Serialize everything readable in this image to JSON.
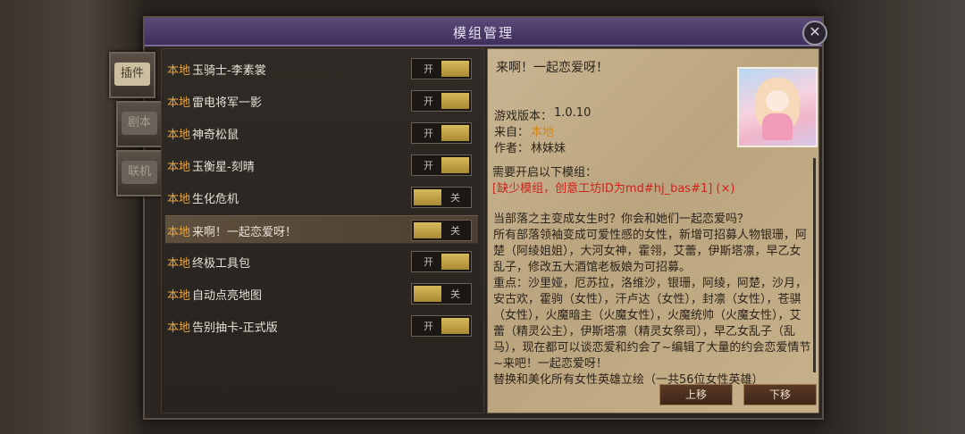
{
  "dialog": {
    "title": "模组管理"
  },
  "side_tabs": [
    {
      "label": "插件",
      "active": true
    },
    {
      "label": "剧本",
      "active": false
    },
    {
      "label": "联机",
      "active": false
    }
  ],
  "mods": [
    {
      "source": "本地",
      "name": "玉骑士-李素裳",
      "state": "开",
      "enabled": true
    },
    {
      "source": "本地",
      "name": "雷电将军一影",
      "state": "开",
      "enabled": true
    },
    {
      "source": "本地",
      "name": "神奇松鼠",
      "state": "开",
      "enabled": true
    },
    {
      "source": "本地",
      "name": "玉衡星-刻晴",
      "state": "开",
      "enabled": true
    },
    {
      "source": "本地",
      "name": "生化危机",
      "state": "关",
      "enabled": false
    },
    {
      "source": "本地",
      "name": "来啊！一起恋爱呀！",
      "state": "关",
      "enabled": false,
      "selected": true
    },
    {
      "source": "本地",
      "name": "终极工具包",
      "state": "开",
      "enabled": true
    },
    {
      "source": "本地",
      "name": "自动点亮地图",
      "state": "关",
      "enabled": false
    },
    {
      "source": "本地",
      "name": "告别抽卡-正式版",
      "state": "开",
      "enabled": true
    }
  ],
  "detail": {
    "title": "来啊！一起恋爱呀！",
    "version_label": "游戏版本：",
    "version": "1.0.10",
    "from_label": "来自：",
    "from": "本地",
    "author_label": "作者：",
    "author": "林妹妹",
    "requires_label": "需要开启以下模组：",
    "requires_missing": "[缺少模组，创意工坊ID为md#hj_bas#1] (×)",
    "description": [
      "当部落之主变成女生时？你会和她们一起恋爱吗？",
      "所有部落领袖变成可爱性感的女性，新增可招募人物银珊，阿楚（阿绫姐姐），大河女神，霍翎，艾蕾，伊斯塔凛，早乙女乱子，修改五大酒馆老板娘为可招募。",
      "重点：沙里娅，厄苏拉，洛维沙，银珊，阿绫，阿楚，沙月，安古欢，霍驹（女性），汗卢达（女性），封凛（女性），苍骐（女性），火魔暗主（火魔女性），火魔统帅（火魔女性），艾蕾（精灵公主），伊斯塔凛（精灵女祭司），早乙女乱子（乱马），现在都可以谈恋爱和约会了~编辑了大量的约会恋爱情节~来吧！一起恋爱呀！",
      "替换和美化所有女性英雄立绘（一共56位女性英雄）"
    ],
    "move_up": "上移",
    "move_down": "下移"
  },
  "colors": {
    "accent_source": "#e8a640",
    "missing_requirement": "#d0221c",
    "toggle_knob": "#c8a548",
    "title_bar": "#4a3a6a"
  }
}
